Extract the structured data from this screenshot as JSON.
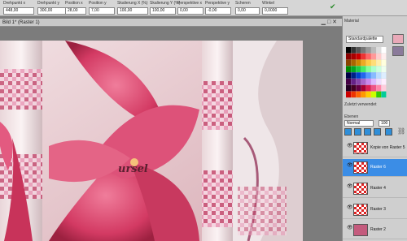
{
  "toolbar": {
    "fields": [
      {
        "label": "Drehpunkt x",
        "value": "448,00"
      },
      {
        "label": "Drehpunkt y",
        "value": "300,00"
      },
      {
        "label": "Position x",
        "value": "28,00"
      },
      {
        "label": "Position y",
        "value": "7,00"
      },
      {
        "label": "Skalierung X (%)",
        "value": "100,00"
      },
      {
        "label": "Skalierung Y (%)",
        "value": "100,00"
      },
      {
        "label": "Perspektive x",
        "value": "0,00"
      },
      {
        "label": "Perspektive y",
        "value": "-0,00"
      },
      {
        "label": "Scheren",
        "value": "0,00"
      },
      {
        "label": "Winkel",
        "value": "0,0000"
      }
    ]
  },
  "document": {
    "title": "Bild 1* (Raster 1)",
    "watermark": "ursel"
  },
  "panel": {
    "material_title": "Material",
    "palette_select": "Standardpalette",
    "recent_title": "Zuletzt verwendet",
    "layers_title": "Ebenen",
    "blend_mode": "Normal",
    "opacity": "100",
    "layers": [
      {
        "name": "Kopie von Raster 5",
        "selected": false
      },
      {
        "name": "Raster 6",
        "selected": true
      },
      {
        "name": "Raster 4",
        "selected": false
      },
      {
        "name": "Raster 3",
        "selected": false
      },
      {
        "name": "Raster 2",
        "selected": false
      }
    ]
  },
  "colors": {
    "selection": "#3b8de6",
    "accent": "#d6326b"
  }
}
